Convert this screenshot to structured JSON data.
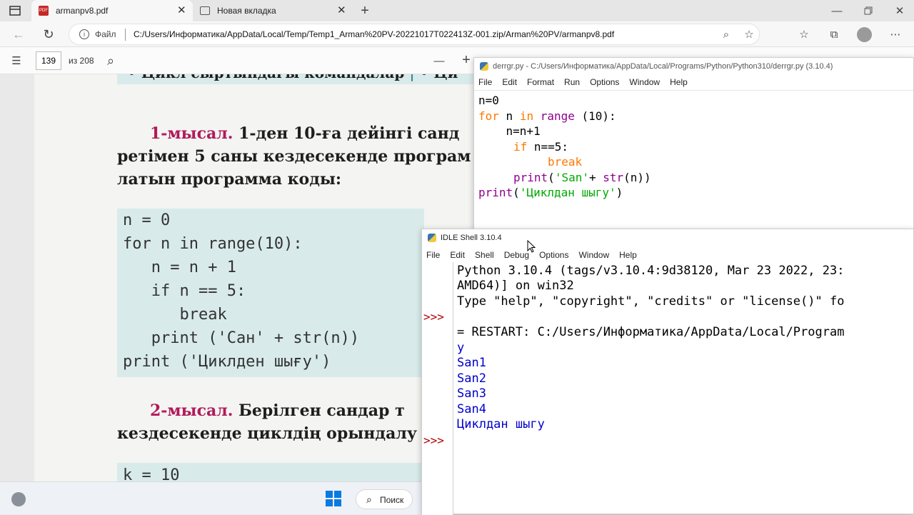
{
  "browser": {
    "tabs": [
      {
        "label": "armanpv8.pdf",
        "active": true
      },
      {
        "label": "Новая вкладка",
        "active": false
      }
    ],
    "url_prefix": "Файл",
    "url": "C:/Users/Информатика/AppData/Local/Temp/Temp1_Arman%20PV-20221017T022413Z-001.zip/Arman%20PV/armanpv8.pdf"
  },
  "pdf_toolbar": {
    "page": "139",
    "page_total": "из 208",
    "zoom_out": "—",
    "zoom_in": "+"
  },
  "book": {
    "top_partial": "• Цикл сыртындағы командалар",
    "top_partial_right": "• Ци",
    "ex1_label": "1-мысал.",
    "ex1_line1": " 1-ден 10-ға дейінгі санд",
    "ex1_line2": "ретімен 5 саны кездесекенде програм",
    "ex1_line3": "латын программа коды:",
    "code": [
      "n = 0",
      "for n in range(10):",
      "   n = n + 1",
      "   if n == 5:",
      "      break",
      "   print ('Сан' + str(n))",
      "print ('Циклден шығу')"
    ],
    "ex2_label": "2-мысал.",
    "ex2_line1": " Берілген сандар т",
    "ex2_line2": "кездесекенде циклдің орындалу",
    "bottom_code": "k = 10"
  },
  "editor": {
    "title": "derrgr.py - C:/Users/Информатика/AppData/Local/Programs/Python/Python310/derrgr.py (3.10.4)",
    "menu": [
      "File",
      "Edit",
      "Format",
      "Run",
      "Options",
      "Window",
      "Help"
    ],
    "code": {
      "l1": "n=0",
      "l2_kw": "for",
      "l2_a": " n ",
      "l2_kw2": "in",
      "l2_b": " ",
      "l2_bi": "range",
      "l2_c": " (10):",
      "l3": "    n=n+1",
      "l4_kw": "if",
      "l4_a": " n==5:",
      "l5_kw": "break",
      "l6_bi": "print",
      "l6_a": "(",
      "l6_st": "'San'",
      "l6_b": "+ ",
      "l6_bi2": "str",
      "l6_c": "(n))",
      "l7_bi": "print",
      "l7_a": "(",
      "l7_st": "'Циклдан шыгу'",
      "l7_b": ")"
    }
  },
  "shell": {
    "title": "IDLE Shell 3.10.4",
    "menu": [
      "File",
      "Edit",
      "Shell",
      "Debug",
      "Options",
      "Window",
      "Help"
    ],
    "prompt": ">>>",
    "lines": {
      "l1": "Python 3.10.4 (tags/v3.10.4:9d38120, Mar 23 2022, 23:",
      "l2": "AMD64)] on win32",
      "l3": "Type \"help\", \"copyright\", \"credits\" or \"license()\" fo",
      "l4": "= RESTART: C:/Users/Информатика/AppData/Local/Program",
      "l5": "y",
      "out": [
        "San1",
        "San2",
        "San3",
        "San4",
        "Циклдан шыгу"
      ]
    }
  },
  "taskbar": {
    "search": "Поиск"
  },
  "colors": {
    "keyword": "#ff7700",
    "builtin": "#900090",
    "string": "#00aa00",
    "output": "#0000cc",
    "prompt": "#b00000"
  }
}
